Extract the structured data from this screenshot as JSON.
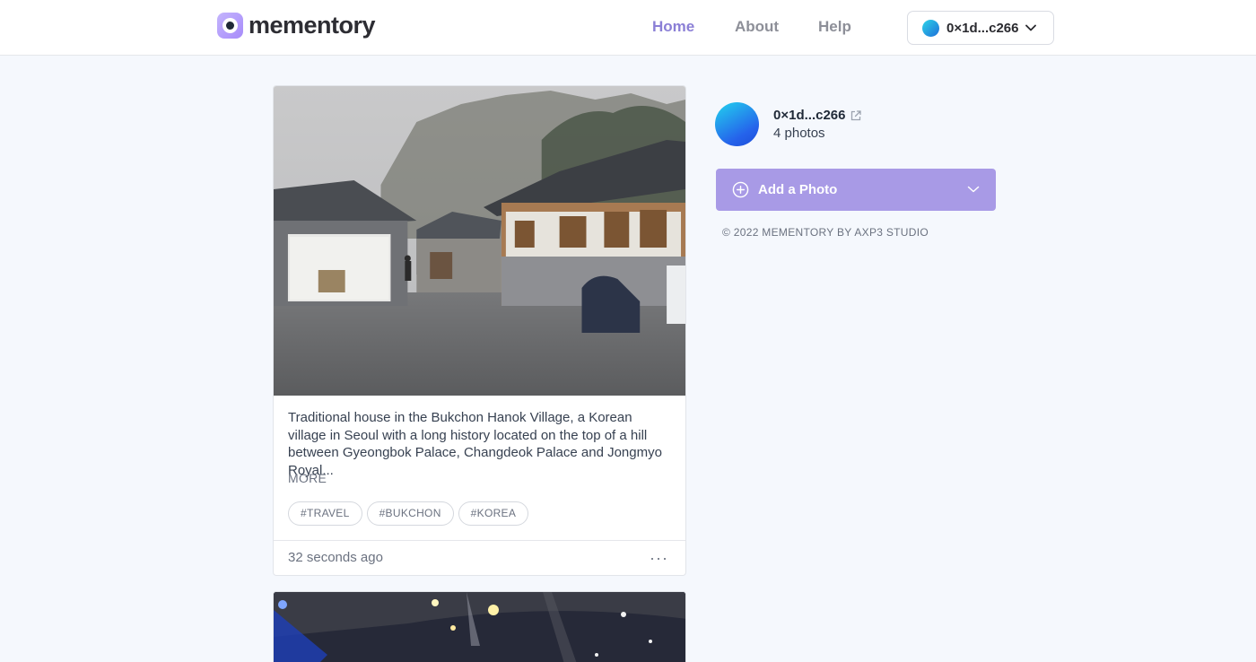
{
  "header": {
    "logo_text": "mementory",
    "nav": [
      {
        "label": "Home",
        "active": true
      },
      {
        "label": "About",
        "active": false
      },
      {
        "label": "Help",
        "active": false
      }
    ],
    "wallet_label": "0×1d...c266"
  },
  "post": {
    "caption": "Traditional house in the Bukchon Hanok Village, a Korean village in Seoul with a long history located on the top of a hill between Gyeongbok Palace, Changdeok Palace and Jongmyo Royal...",
    "more_label": "MORE",
    "tags": [
      "#TRAVEL",
      "#BUKCHON",
      "#KOREA"
    ],
    "timestamp": "32 seconds ago",
    "menu_label": "···"
  },
  "profile": {
    "name": "0×1d...c266",
    "photo_count": "4 photos"
  },
  "add_photo": {
    "label": "Add a Photo"
  },
  "footer": {
    "copyright": "© 2022 MEMENTORY BY AXP3 STUDIO"
  },
  "colors": {
    "accent": "#a89ae6",
    "nav_active": "#8b7fd6",
    "background": "#f5f8fd"
  }
}
